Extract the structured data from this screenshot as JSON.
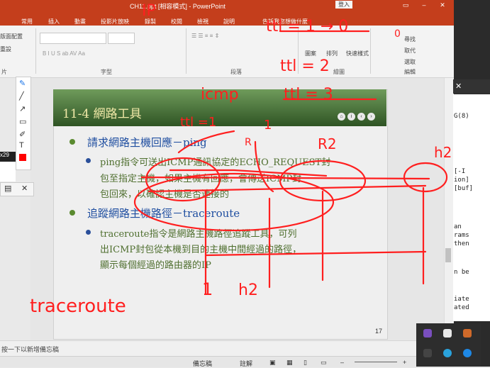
{
  "window": {
    "title": "CH11.ppt [相容模式] - PowerPoint",
    "signin": "登入"
  },
  "tabs": [
    "檔案",
    "常用",
    "插入",
    "轉場",
    "動畫",
    "投影片放映",
    "錄製",
    "校閱",
    "檢視",
    "說明",
    "告訴我您想做什麼"
  ],
  "ribbon": {
    "slide_layout": "版面配置",
    "reset": "重設",
    "section": "章節",
    "groups": [
      "片",
      "字型",
      "段落",
      "繪圖",
      "編輯"
    ],
    "drawing_items": [
      "圖案",
      "排列",
      "快速樣式"
    ],
    "editing_items": [
      "尋找",
      "取代",
      "選取"
    ]
  },
  "slide": {
    "title": "11-4 網路工具",
    "bullets": [
      {
        "level": 1,
        "text": "請求網路主機回應－ping"
      },
      {
        "level": 2,
        "lines": [
          "ping指令可送出ICMP通訊協定的ECHO_REQUEST封",
          "包至指定主機，如果主機有回應，會傳送ICMP封",
          "包回來，以確認主機是否連接的"
        ]
      },
      {
        "level": 1,
        "text": "追蹤網路主機路徑－traceroute"
      },
      {
        "level": 2,
        "lines": [
          "traceroute指令是網路主機路徑追蹤工具，可列",
          "出ICMP封包從本機到目的主機中間經過的路徑，",
          "顯示每個經過的路由器的IP"
        ]
      }
    ],
    "page_number": "17"
  },
  "notes_placeholder": "按一下以新增備忘稿",
  "status": {
    "notes": "備忘稿",
    "comments": "註解"
  },
  "pen": {
    "zoom": "x29"
  },
  "terminal_lines": [
    {
      "text": "G(8)"
    },
    {
      "text": "[-I"
    },
    {
      "text": "ion]"
    },
    {
      "text": "[buf]"
    },
    {
      "text": "an"
    },
    {
      "text": "rams"
    },
    {
      "text": "then"
    },
    {
      "text": "n be"
    },
    {
      "text": "iate"
    },
    {
      "text": "ated"
    }
  ],
  "ink_labels": {
    "ip": "IP",
    "ttl0": "ttl = 1 → 0",
    "ttl2": "ttl = 2",
    "icmp": "icmp",
    "ttl3": "ttl = 3",
    "ttl1": "ttl =1",
    "one": "1",
    "r2": "R2",
    "h2": "h2",
    "r1": "1",
    "bottom_one": "1",
    "bottom_h2": "h2",
    "traceroute": "traceroute",
    "small_r": "R",
    "zero": "0"
  },
  "colors": {
    "ink": "#ff1f1f",
    "title_bar": "#c43e1c",
    "slide_header": "#3d6a2e"
  }
}
